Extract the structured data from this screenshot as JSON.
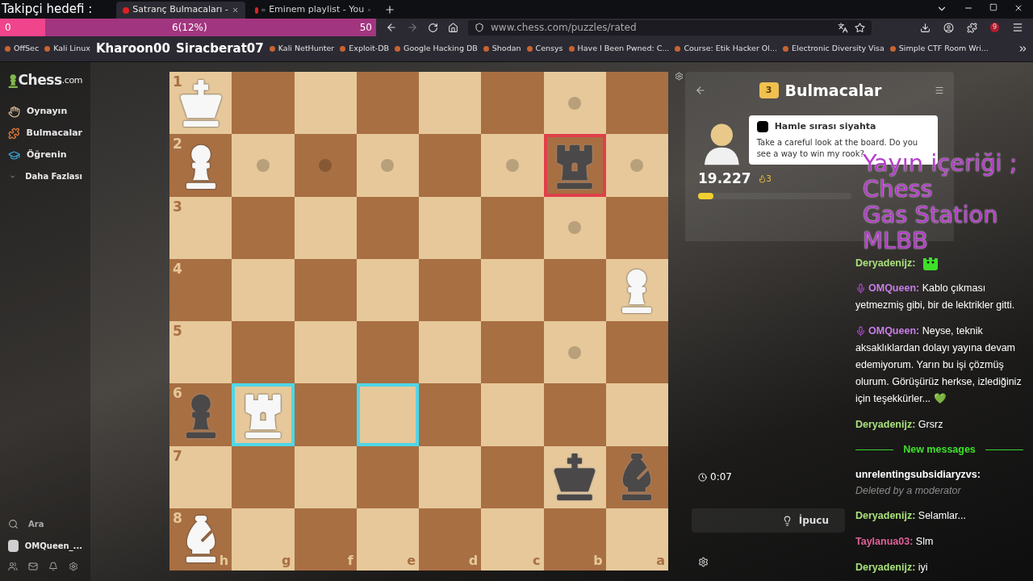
{
  "follower_goal": {
    "title": "Takipçi hedefi :",
    "start": "0",
    "current": "6(12%)",
    "end": "50",
    "level": 0.12
  },
  "browser": {
    "tabs": [
      {
        "title": "Satranç Bulmacaları -",
        "selected": true,
        "audio": false
      },
      {
        "title": "Eminem playlist - You",
        "selected": false,
        "audio": true
      }
    ],
    "url": "www.chess.com/puzzles/rated",
    "bookmarks": [
      "OffSec",
      "Kali Linux",
      "Kali NetHunter",
      "Exploit-DB",
      "Google Hacking DB",
      "Shodan",
      "Censys",
      "Have I Been Pwned: C...",
      "Course: Etik Hacker Ol...",
      "Electronic Diversity Visa",
      "Simple CTF Room Wri..."
    ],
    "extension_badge": "9"
  },
  "stream_names": [
    "Kharoon00",
    "Siracberat07"
  ],
  "sidebar": {
    "logo": "Chess",
    "logo_suffix": ".com",
    "items": [
      "Oynayın",
      "Bulmacalar",
      "Öğrenin"
    ],
    "more": "Daha Fazlası",
    "search": "Ara",
    "user": "OMQueen_..."
  },
  "board": {
    "files": [
      "h",
      "g",
      "f",
      "e",
      "d",
      "c",
      "b",
      "a"
    ],
    "rows": [
      {
        "label": "1",
        "cells": [
          {
            "kind": "king",
            "white": true
          },
          {},
          {},
          {},
          {},
          {},
          {
            "dot": true
          },
          {}
        ]
      },
      {
        "label": "2",
        "cells": [
          {
            "kind": "pawn",
            "white": true
          },
          {
            "dot": true
          },
          {
            "dot": true
          },
          {
            "dot": true
          },
          {},
          {
            "dot": true
          },
          {
            "kind": "rook",
            "white": false,
            "color": "#e0404a"
          },
          {
            "dot": true
          }
        ]
      },
      {
        "label": "3",
        "cells": [
          {},
          {},
          {},
          {},
          {},
          {},
          {
            "dot": true
          },
          {}
        ]
      },
      {
        "label": "4",
        "cells": [
          {},
          {},
          {},
          {},
          {},
          {},
          {},
          {
            "kind": "pawn",
            "white": true
          }
        ]
      },
      {
        "label": "5",
        "cells": [
          {},
          {},
          {},
          {},
          {},
          {},
          {
            "dot": true
          },
          {}
        ]
      },
      {
        "label": "6",
        "cells": [
          {
            "kind": "pawn",
            "white": false
          },
          {
            "kind": "rook",
            "white": true,
            "color": "#4fd6e8"
          },
          {},
          {
            "color": "#4fd6e8"
          },
          {},
          {},
          {},
          {}
        ]
      },
      {
        "label": "7",
        "cells": [
          {},
          {},
          {},
          {},
          {},
          {},
          {
            "kind": "king",
            "white": false
          },
          {
            "kind": "bishop",
            "white": false
          }
        ]
      },
      {
        "label": "8",
        "cells": [
          {
            "kind": "bishop",
            "white": true
          },
          {},
          {},
          {},
          {},
          {},
          {},
          {}
        ]
      }
    ]
  },
  "puzzle": {
    "title": "Bulmacalar",
    "badge": "3",
    "bubble_title": "Hamle sırası siyahta",
    "bubble_text": "Take a careful look at the board. Do you see a way to win my rook?",
    "rating": "19.227",
    "streak": "3",
    "level": 0.1,
    "timer": "0:07",
    "hint": "İpucu"
  },
  "stream_text": [
    "Yayın içeriği ;",
    "Chess",
    "Gas Station",
    "MLBB"
  ],
  "chat": [
    {
      "kind": "emote",
      "name": "Deryadenijz:",
      "color": "#a8e07a",
      "moderator": false
    },
    {
      "kind": "message",
      "name": "OMQueen:",
      "color": "#c77ee8",
      "moderator": true,
      "text": "Kablo çıkması yetmezmiş gibi, bir de lektrikler gitti."
    },
    {
      "kind": "message",
      "name": "OMQueen:",
      "color": "#c77ee8",
      "moderator": true,
      "text": "Neyse, teknik aksaklıklardan dolayı yayına devam edemiyorum. Yarın bu işi çözmüş olurum. Görüşürüz herkse, izlediğiniz için teşekkürler... 💚"
    },
    {
      "kind": "message",
      "name": "Deryadenijz:",
      "color": "#a8e07a",
      "moderator": false,
      "text": "Grsrz"
    },
    {
      "kind": "divider",
      "text": "New messages"
    },
    {
      "kind": "deleted",
      "name": "unrelentingsubsidiaryzvs:",
      "color": "#ffffff",
      "moderator": false,
      "text": "Deleted by a moderator"
    },
    {
      "kind": "message",
      "name": "Deryadenijz:",
      "color": "#a8e07a",
      "moderator": false,
      "text": "Selamlar..."
    },
    {
      "kind": "message",
      "name": "Taylanua03:",
      "color": "#e0609a",
      "moderator": false,
      "text": "Slm"
    },
    {
      "kind": "message",
      "name": "Deryadenijz:",
      "color": "#a8e07a",
      "moderator": false,
      "text": "iyi"
    }
  ]
}
